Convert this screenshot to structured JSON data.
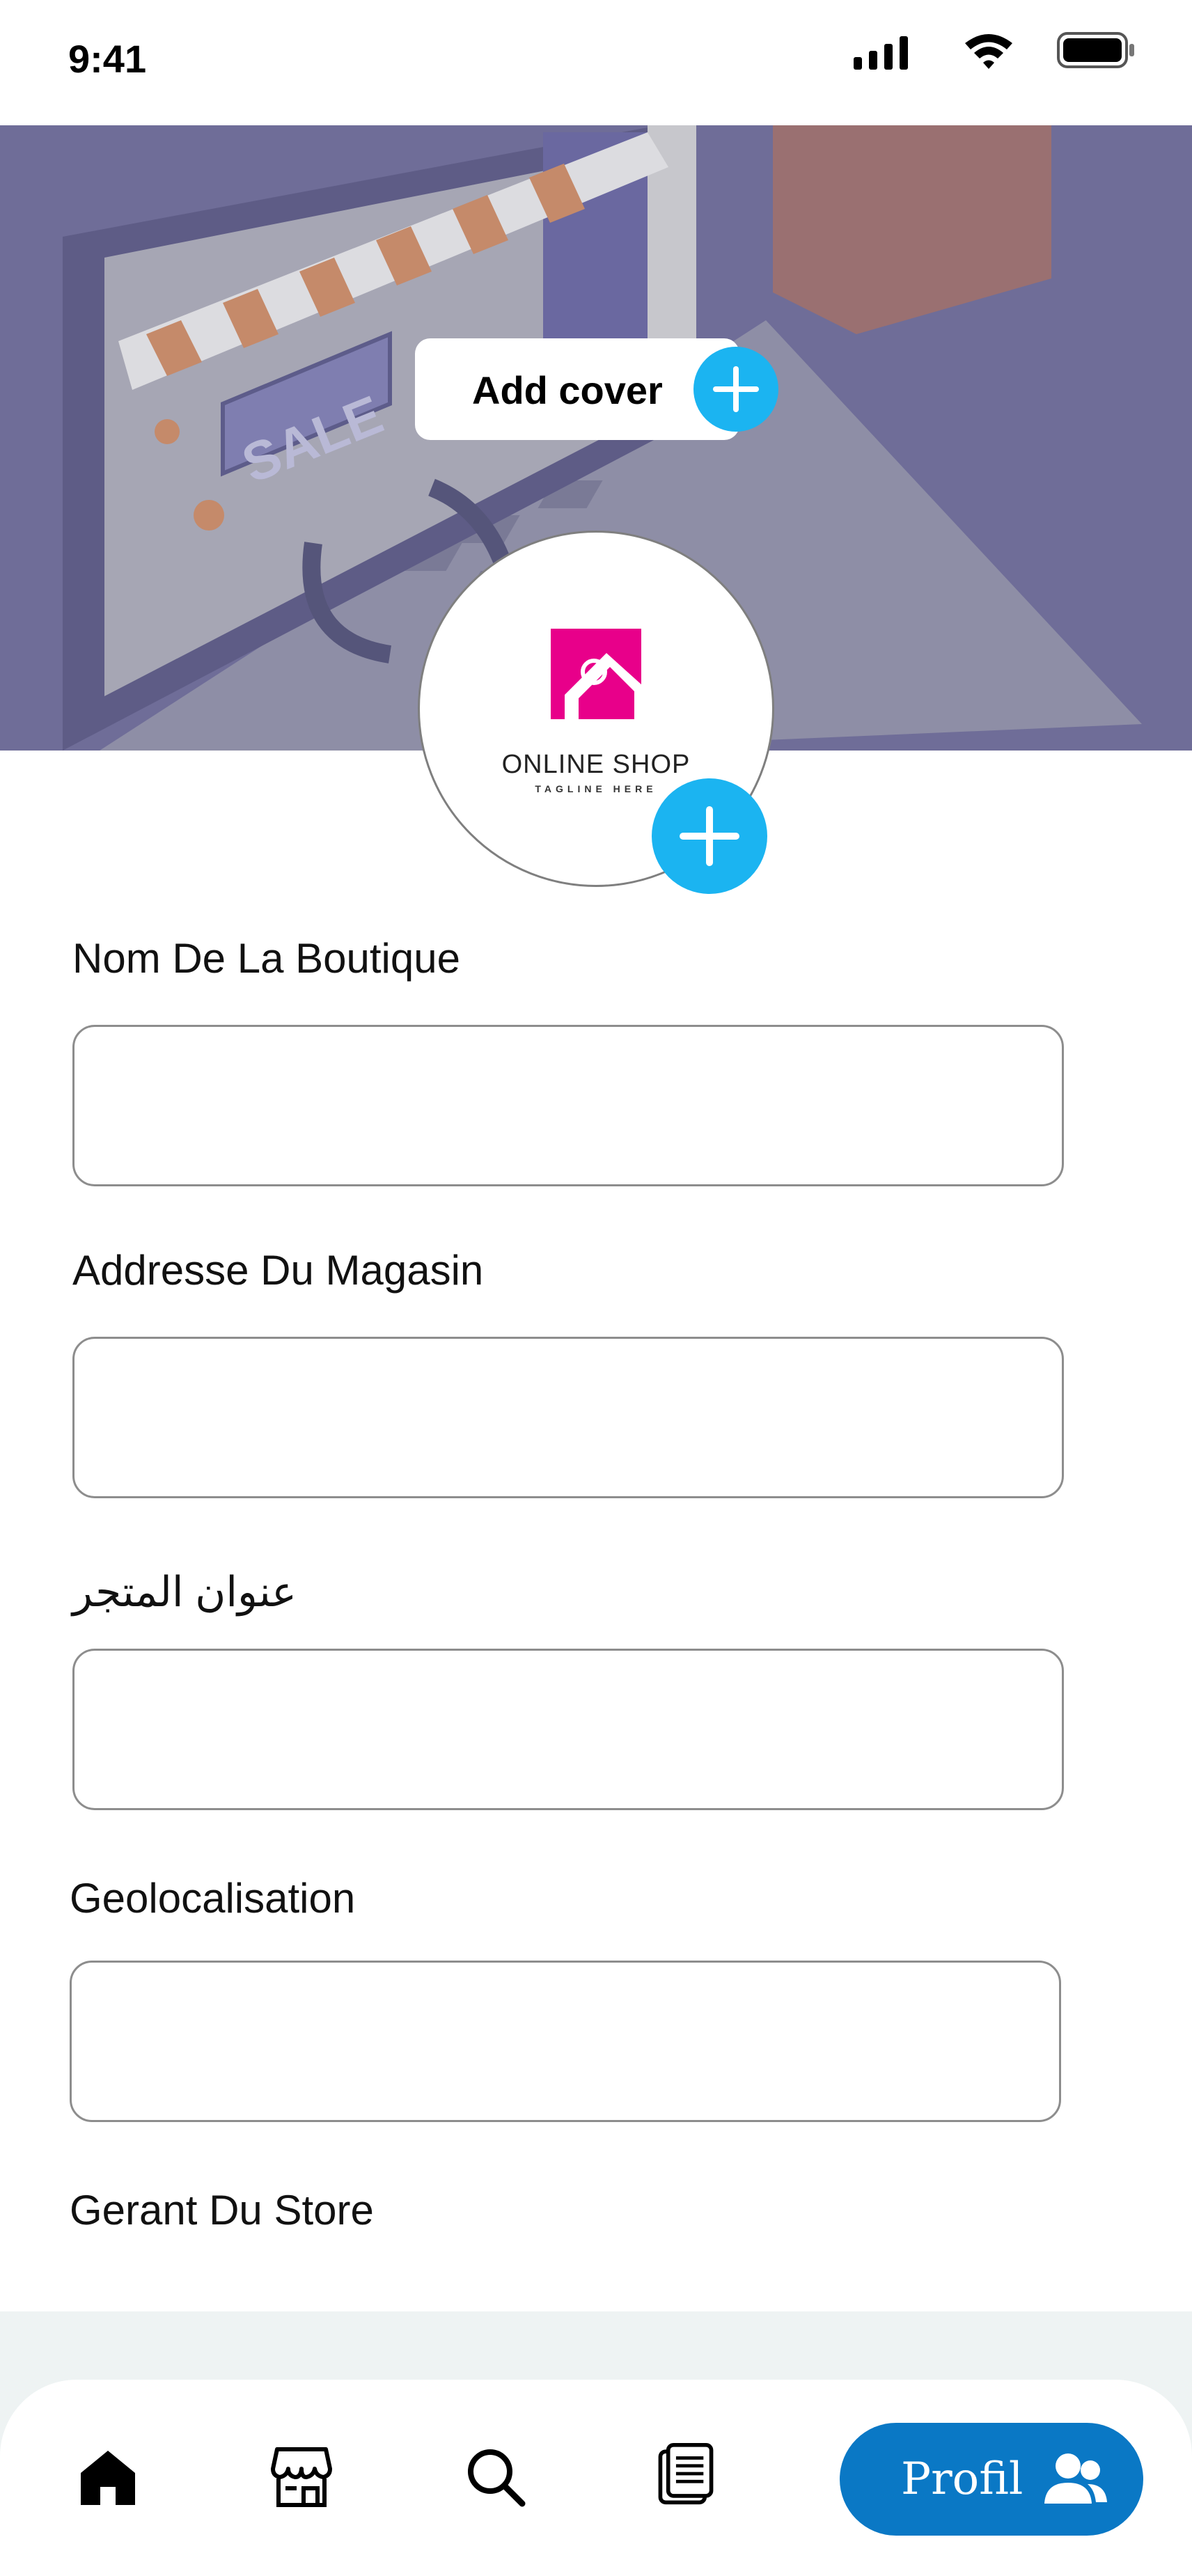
{
  "status_bar": {
    "time": "9:41",
    "icons": [
      "signal-icon",
      "wifi-icon",
      "battery-icon"
    ]
  },
  "cover": {
    "sale_sign_text": "SALE",
    "add_cover_label": "Add cover",
    "plus_icon": "plus-icon"
  },
  "logo": {
    "title": "ONLINE SHOP",
    "tagline": "TAGLINE HERE",
    "brand_color": "#e8008a"
  },
  "form": {
    "fields": [
      {
        "label": "Nom De La Boutique",
        "value": "",
        "placeholder": ""
      },
      {
        "label": "Addresse Du Magasin",
        "value": "",
        "placeholder": ""
      },
      {
        "label": "عنوان المتجر",
        "value": "",
        "placeholder": ""
      },
      {
        "label": "Geolocalisation",
        "value": "",
        "placeholder": ""
      },
      {
        "label": "Gerant Du Store"
      }
    ]
  },
  "bottom_nav": {
    "items": [
      {
        "icon": "home-icon",
        "active": true
      },
      {
        "icon": "store-icon"
      },
      {
        "icon": "search-icon"
      },
      {
        "icon": "document-icon"
      }
    ],
    "profile_label": "Profil",
    "profile_icon": "users-icon"
  },
  "colors": {
    "accent_plus": "#1bb4f1",
    "profile_pill": "#0a78c5",
    "cover_overlay": "#6f6d98"
  }
}
